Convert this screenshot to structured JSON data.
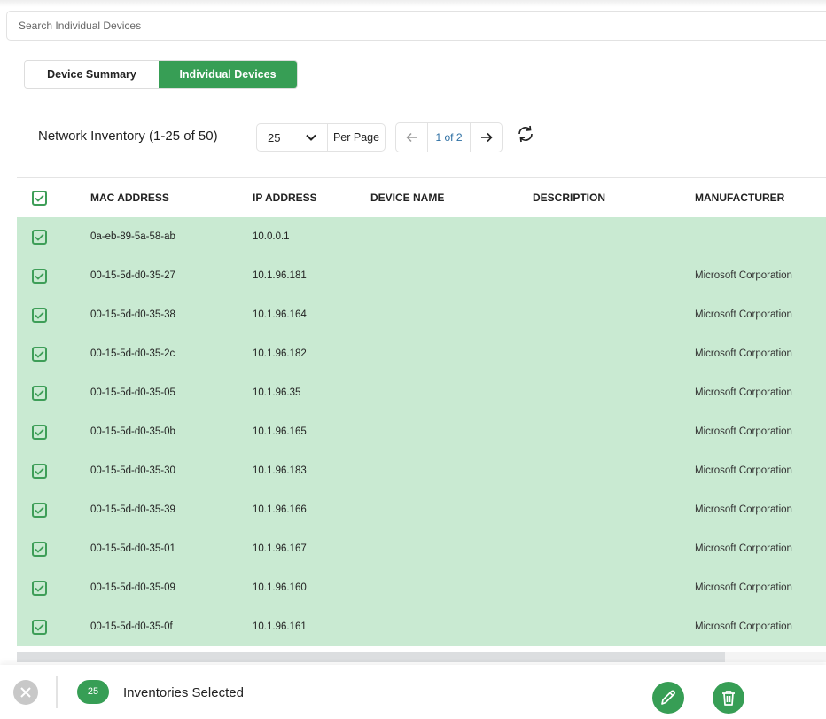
{
  "search": {
    "placeholder": "Search Individual Devices",
    "value": ""
  },
  "tabs": [
    {
      "label": "Device Summary",
      "active": false
    },
    {
      "label": "Individual Devices",
      "active": true
    }
  ],
  "header": {
    "title": "Network Inventory (1-25 of 50)",
    "per_page_value": "25",
    "per_page_label": "Per Page",
    "page_info": "1 of 2"
  },
  "icons": {
    "search": "search-icon",
    "chevron": "chevron-down-icon",
    "prev": "arrow-left-icon",
    "next": "arrow-right-icon",
    "refresh": "refresh-icon",
    "checkbox": "checkbox-checked-icon",
    "close": "close-icon",
    "edit": "pencil-icon",
    "delete": "trash-icon"
  },
  "colors": {
    "accent": "#379e55",
    "row_selected": "#c9ead2",
    "page_link": "#2d6fa3"
  },
  "table": {
    "columns": [
      "MAC ADDRESS",
      "IP ADDRESS",
      "DEVICE NAME",
      "DESCRIPTION",
      "MANUFACTURER"
    ],
    "all_selected": true,
    "rows": [
      {
        "mac": "0a-eb-89-5a-58-ab",
        "ip": "10.0.0.1",
        "name": "",
        "description": "",
        "manufacturer": "",
        "selected": true
      },
      {
        "mac": "00-15-5d-d0-35-27",
        "ip": "10.1.96.181",
        "name": "",
        "description": "",
        "manufacturer": "Microsoft Corporation",
        "selected": true
      },
      {
        "mac": "00-15-5d-d0-35-38",
        "ip": "10.1.96.164",
        "name": "",
        "description": "",
        "manufacturer": "Microsoft Corporation",
        "selected": true
      },
      {
        "mac": "00-15-5d-d0-35-2c",
        "ip": "10.1.96.182",
        "name": "",
        "description": "",
        "manufacturer": "Microsoft Corporation",
        "selected": true
      },
      {
        "mac": "00-15-5d-d0-35-05",
        "ip": "10.1.96.35",
        "name": "",
        "description": "",
        "manufacturer": "Microsoft Corporation",
        "selected": true
      },
      {
        "mac": "00-15-5d-d0-35-0b",
        "ip": "10.1.96.165",
        "name": "",
        "description": "",
        "manufacturer": "Microsoft Corporation",
        "selected": true
      },
      {
        "mac": "00-15-5d-d0-35-30",
        "ip": "10.1.96.183",
        "name": "",
        "description": "",
        "manufacturer": "Microsoft Corporation",
        "selected": true
      },
      {
        "mac": "00-15-5d-d0-35-39",
        "ip": "10.1.96.166",
        "name": "",
        "description": "",
        "manufacturer": "Microsoft Corporation",
        "selected": true
      },
      {
        "mac": "00-15-5d-d0-35-01",
        "ip": "10.1.96.167",
        "name": "",
        "description": "",
        "manufacturer": "Microsoft Corporation",
        "selected": true
      },
      {
        "mac": "00-15-5d-d0-35-09",
        "ip": "10.1.96.160",
        "name": "",
        "description": "",
        "manufacturer": "Microsoft Corporation",
        "selected": true
      },
      {
        "mac": "00-15-5d-d0-35-0f",
        "ip": "10.1.96.161",
        "name": "",
        "description": "",
        "manufacturer": "Microsoft Corporation",
        "selected": true
      }
    ]
  },
  "footer": {
    "selected_count": "25",
    "selected_label": "Inventories Selected"
  }
}
